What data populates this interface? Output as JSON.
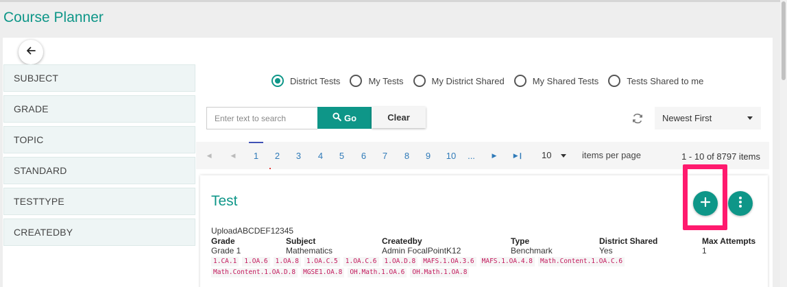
{
  "app": {
    "title": "Course Planner"
  },
  "sidebar": {
    "items": [
      {
        "label": "SUBJECT"
      },
      {
        "label": "GRADE"
      },
      {
        "label": "TOPIC"
      },
      {
        "label": "STANDARD"
      },
      {
        "label": "TESTTYPE"
      },
      {
        "label": "CREATEDBY"
      }
    ]
  },
  "filters": {
    "radios": [
      {
        "label": "District Tests",
        "checked": true
      },
      {
        "label": "My Tests",
        "checked": false
      },
      {
        "label": "My District Shared",
        "checked": false
      },
      {
        "label": "My Shared Tests",
        "checked": false
      },
      {
        "label": "Tests Shared to me",
        "checked": false
      }
    ]
  },
  "search": {
    "placeholder": "Enter text to search",
    "value": "",
    "go_label": "Go",
    "clear_label": "Clear"
  },
  "sort": {
    "selected": "Newest First"
  },
  "pagination": {
    "pages": [
      "1",
      "2",
      "3",
      "4",
      "5",
      "6",
      "7",
      "8",
      "9",
      "10",
      "..."
    ],
    "current": "1",
    "page_size": "10",
    "items_per_page_label": "items per page",
    "info": "1 - 10 of 8797 items"
  },
  "test": {
    "title": "Test",
    "code": "UploadABCDEF12345",
    "columns": [
      {
        "header": "Grade",
        "value": "Grade 1"
      },
      {
        "header": "Subject",
        "value": "Mathematics"
      },
      {
        "header": "Createdby",
        "value": "Admin FocalPointK12"
      },
      {
        "header": "Type",
        "value": "Benchmark"
      },
      {
        "header": "District Shared",
        "value": "Yes"
      },
      {
        "header": "Max Attempts",
        "value": "1"
      }
    ],
    "tags": [
      "1.CA.1",
      "1.OA.6",
      "1.OA.8",
      "1.OA.C.5",
      "1.OA.C.6",
      "1.OA.D.8",
      "MAFS.1.OA.3.6",
      "MAFS.1.OA.4.8",
      "Math.Content.1.OA.C.6",
      "Math.Content.1.OA.D.8",
      "MGSE1.OA.8",
      "OH.Math.1.OA.6",
      "OH.Math.1.OA.8"
    ]
  },
  "colors": {
    "accent": "#0e9688",
    "highlight": "#ff1a6e",
    "tag_text": "#c2185b",
    "link": "#2f7ab8"
  },
  "icons": {
    "back": "arrow-left-icon",
    "search": "search-icon",
    "refresh": "refresh-icon",
    "add": "plus-icon",
    "more": "more-vertical-icon"
  }
}
